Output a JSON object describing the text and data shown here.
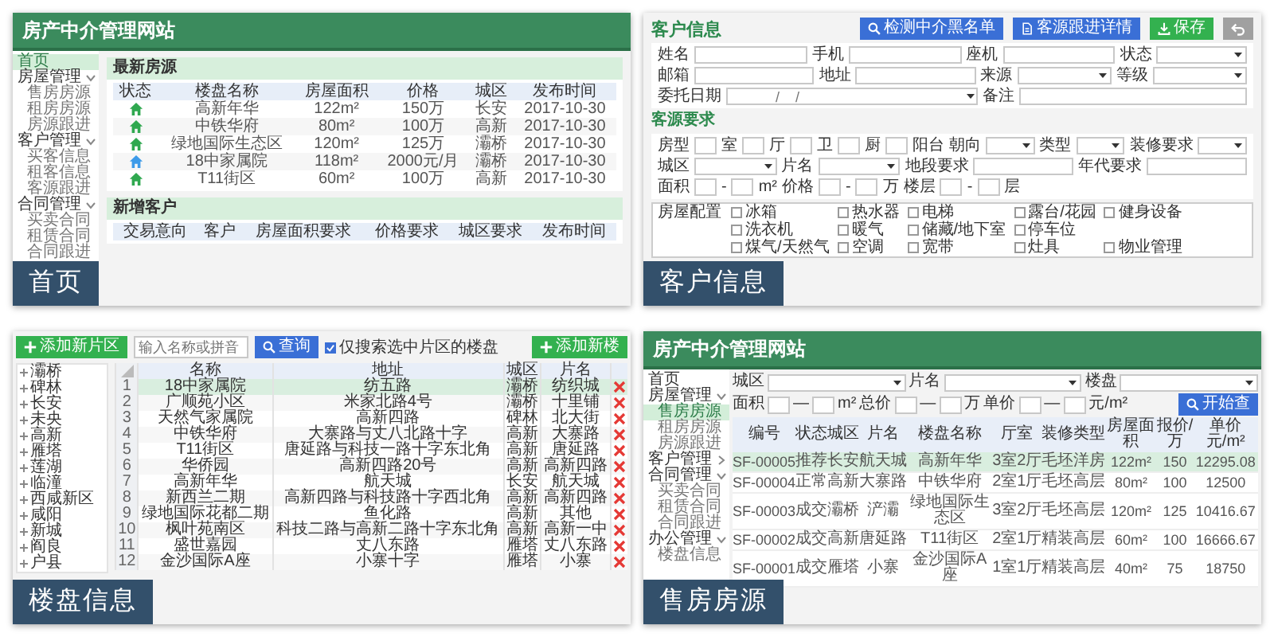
{
  "home_panel": {
    "site_title": "房产中介管理网站",
    "sidebar": [
      {
        "label": "首页",
        "selected": true
      },
      {
        "label": "房屋管理",
        "selected": false,
        "expanded": true,
        "children": [
          {
            "label": "售房房源",
            "selected": false
          },
          {
            "label": "租房房源",
            "selected": false
          },
          {
            "label": "房源跟进",
            "selected": false
          }
        ]
      },
      {
        "label": "客户管理",
        "selected": false,
        "expanded": true,
        "children": [
          {
            "label": "买客信息",
            "selected": false
          },
          {
            "label": "租客信息",
            "selected": false
          },
          {
            "label": "客源跟进",
            "selected": false
          }
        ]
      },
      {
        "label": "合同管理",
        "selected": false,
        "expanded": true,
        "children": [
          {
            "label": "买卖合同",
            "selected": false
          },
          {
            "label": "租赁合同",
            "selected": false
          },
          {
            "label": "合同跟进",
            "selected": false
          }
        ]
      }
    ],
    "latest_listings": {
      "title": "最新房源",
      "columns": [
        "状态",
        "楼盘名称",
        "房屋面积",
        "价格",
        "城区",
        "发布时间"
      ],
      "rows": [
        {
          "kind": "sale",
          "cells": [
            "",
            "高新年华",
            "122m²",
            "150万",
            "长安",
            "2017-10-30"
          ]
        },
        {
          "kind": "sale",
          "cells": [
            "",
            "中铁华府",
            "80m²",
            "100万",
            "高新",
            "2017-10-30"
          ]
        },
        {
          "kind": "sale",
          "cells": [
            "",
            "绿地国际生态区",
            "120m²",
            "125万",
            "灞桥",
            "2017-10-30"
          ]
        },
        {
          "kind": "rent",
          "cells": [
            "",
            "18中家属院",
            "118m²",
            "2000元/月",
            "灞桥",
            "2017-10-30"
          ]
        },
        {
          "kind": "sale",
          "cells": [
            "",
            "T11街区",
            "60m²",
            "100万",
            "高新",
            "2017-10-30"
          ]
        }
      ]
    },
    "new_customers": {
      "title": "新增客户",
      "columns": [
        "交易意向",
        "客户",
        "房屋面积要求",
        "价格要求",
        "城区要求",
        "发布时间"
      ]
    },
    "caption": "首页"
  },
  "customer_panel": {
    "title": "客户信息",
    "buttons": [
      {
        "kind": "search",
        "label": "检测中介黑名单"
      },
      {
        "kind": "document",
        "label": "客源跟进详情"
      },
      {
        "kind": "save",
        "label": "保存"
      },
      {
        "kind": "back"
      }
    ],
    "form_rows": [
      [
        {
          "kind": "text",
          "text": "姓名"
        },
        {
          "kind": "input"
        },
        {
          "kind": "text",
          "text": "手机"
        },
        {
          "kind": "input"
        },
        {
          "kind": "text",
          "text": "座机"
        },
        {
          "kind": "input"
        },
        {
          "kind": "text",
          "text": "状态"
        },
        {
          "kind": "select"
        }
      ],
      [
        {
          "kind": "text",
          "text": "邮箱"
        },
        {
          "kind": "input"
        },
        {
          "kind": "text",
          "text": "地址"
        },
        {
          "kind": "input"
        },
        {
          "kind": "text",
          "text": "来源"
        },
        {
          "kind": "select"
        },
        {
          "kind": "text",
          "text": "等级"
        },
        {
          "kind": "select"
        }
      ],
      [
        {
          "kind": "text",
          "text": "委托日期"
        },
        {
          "kind": "date",
          "placeholder": "____/__/__"
        },
        {
          "kind": "text",
          "text": "备注"
        },
        {
          "kind": "input"
        }
      ]
    ],
    "requirements_title": "客源要求",
    "requirement_rows": [
      [
        {
          "kind": "text",
          "text": "房型"
        },
        {
          "kind": "short"
        },
        {
          "kind": "text",
          "text": "室"
        },
        {
          "kind": "short"
        },
        {
          "kind": "text",
          "text": "厅"
        },
        {
          "kind": "short"
        },
        {
          "kind": "text",
          "text": "卫"
        },
        {
          "kind": "short"
        },
        {
          "kind": "text",
          "text": "厨"
        },
        {
          "kind": "short"
        },
        {
          "kind": "text",
          "text": "阳台"
        },
        {
          "kind": "text",
          "text": "朝向"
        },
        {
          "kind": "select"
        },
        {
          "kind": "text",
          "text": "类型"
        },
        {
          "kind": "select"
        },
        {
          "kind": "text",
          "text": "装修要求"
        },
        {
          "kind": "select"
        }
      ],
      [
        {
          "kind": "text",
          "text": "城区"
        },
        {
          "kind": "select"
        },
        {
          "kind": "text",
          "text": "片名"
        },
        {
          "kind": "select"
        },
        {
          "kind": "text",
          "text": "地段要求"
        },
        {
          "kind": "input"
        },
        {
          "kind": "text",
          "text": "年代要求"
        },
        {
          "kind": "input"
        }
      ],
      [
        {
          "kind": "text",
          "text": "面积"
        },
        {
          "kind": "short"
        },
        {
          "kind": "text",
          "text": "-"
        },
        {
          "kind": "short"
        },
        {
          "kind": "text",
          "text": "m²"
        },
        {
          "kind": "text",
          "text": "价格"
        },
        {
          "kind": "short"
        },
        {
          "kind": "text",
          "text": "-"
        },
        {
          "kind": "short"
        },
        {
          "kind": "text",
          "text": "万"
        },
        {
          "kind": "text",
          "text": "楼层"
        },
        {
          "kind": "short"
        },
        {
          "kind": "text",
          "text": "-"
        },
        {
          "kind": "short"
        },
        {
          "kind": "text",
          "text": "层"
        }
      ]
    ],
    "facilities": {
      "label": "房屋配置",
      "rows": [
        [
          {
            "label": "冰箱",
            "checked": false
          },
          {
            "label": "热水器",
            "checked": false
          },
          {
            "label": "电梯",
            "checked": false
          },
          {
            "label": "露台/花园",
            "checked": false
          },
          {
            "label": "健身设备",
            "checked": false
          }
        ],
        [
          {
            "label": "洗衣机",
            "checked": false
          },
          {
            "label": "暖气",
            "checked": false
          },
          {
            "label": "储藏/地下室",
            "checked": false
          },
          {
            "label": "停车位",
            "checked": false
          }
        ],
        [
          {
            "label": "煤气/天然气",
            "checked": false
          },
          {
            "label": "空调",
            "checked": false
          },
          {
            "label": "宽带",
            "checked": false
          },
          {
            "label": "灶具",
            "checked": false
          },
          {
            "label": "物业管理",
            "checked": false
          }
        ]
      ]
    },
    "caption": "客户信息"
  },
  "estate_panel": {
    "add_district_button": "添加新片区",
    "search_placeholder": "输入名称或拼音",
    "query_button": "查询",
    "filter_checkbox": {
      "label": "仅搜索选中片区的楼盘",
      "checked": true
    },
    "add_estate_button": "添加新楼",
    "districts": [
      {
        "label": "灞桥",
        "expanded": false
      },
      {
        "label": "碑林",
        "expanded": false
      },
      {
        "label": "长安",
        "expanded": false
      },
      {
        "label": "未央",
        "expanded": false
      },
      {
        "label": "高新",
        "expanded": false
      },
      {
        "label": "雁塔",
        "expanded": false
      },
      {
        "label": "莲湖",
        "expanded": false
      },
      {
        "label": "临潼",
        "expanded": false
      },
      {
        "label": "西咸新区",
        "expanded": false
      },
      {
        "label": "咸阳",
        "expanded": false
      },
      {
        "label": "新城",
        "expanded": false
      },
      {
        "label": "阎良",
        "expanded": false
      },
      {
        "label": "户县",
        "expanded": false
      }
    ],
    "table": {
      "columns": [
        "名称",
        "地址",
        "城区",
        "片名"
      ],
      "rows": [
        {
          "number": "1",
          "selected": true,
          "cells": [
            "18中家属院",
            "纺五路",
            "灞桥",
            "纺织城"
          ]
        },
        {
          "number": "2",
          "selected": false,
          "cells": [
            "广顺苑小区",
            "米家北路4号",
            "灞桥",
            "十里铺"
          ]
        },
        {
          "number": "3",
          "selected": false,
          "cells": [
            "天然气家属院",
            "高新四路",
            "碑林",
            "北大街"
          ]
        },
        {
          "number": "4",
          "selected": false,
          "cells": [
            "中铁华府",
            "大寨路与丈八北路十字",
            "高新",
            "大寨路"
          ]
        },
        {
          "number": "5",
          "selected": false,
          "cells": [
            "T11街区",
            "唐延路与科技一路十字东北角",
            "高新",
            "唐延路"
          ]
        },
        {
          "number": "6",
          "selected": false,
          "cells": [
            "华侨园",
            "高新四路20号",
            "高新",
            "高新四路"
          ]
        },
        {
          "number": "7",
          "selected": false,
          "cells": [
            "高新年华",
            "航天城",
            "长安",
            "航天城"
          ]
        },
        {
          "number": "8",
          "selected": false,
          "cells": [
            "新西兰二期",
            "高新四路与科技路十字西北角",
            "高新",
            "高新四路"
          ]
        },
        {
          "number": "9",
          "selected": false,
          "cells": [
            "绿地国际花都二期",
            "鱼化路",
            "高新",
            "其他"
          ]
        },
        {
          "number": "10",
          "selected": false,
          "cells": [
            "枫叶苑南区",
            "科技二路与高新二路十字东北角",
            "高新",
            "高新一中"
          ]
        },
        {
          "number": "11",
          "selected": false,
          "cells": [
            "盛世嘉园",
            "丈八东路",
            "雁塔",
            "丈八东路"
          ]
        },
        {
          "number": "12",
          "selected": false,
          "cells": [
            "金沙国际A座",
            "小寨十字",
            "雁塔",
            "小寨"
          ]
        }
      ]
    },
    "caption": "楼盘信息"
  },
  "sale_panel": {
    "site_title": "房产中介管理网站",
    "sidebar": [
      {
        "label": "首页",
        "selected": false
      },
      {
        "label": "房屋管理",
        "selected": false,
        "expanded": true,
        "children": [
          {
            "label": "售房房源",
            "selected": true
          },
          {
            "label": "租房房源",
            "selected": false
          },
          {
            "label": "房源跟进",
            "selected": false
          }
        ]
      },
      {
        "label": "客户管理",
        "selected": false,
        "expanded": false
      },
      {
        "label": "合同管理",
        "selected": false,
        "expanded": true,
        "children": [
          {
            "label": "买卖合同",
            "selected": false
          },
          {
            "label": "租赁合同",
            "selected": false
          },
          {
            "label": "合同跟进",
            "selected": false
          }
        ]
      },
      {
        "label": "办公管理",
        "selected": false,
        "expanded": true,
        "children": [
          {
            "label": "楼盘信息",
            "selected": false
          }
        ]
      }
    ],
    "filter_rows": [
      [
        {
          "kind": "text",
          "text": "城区"
        },
        {
          "kind": "select"
        },
        {
          "kind": "text",
          "text": "片名"
        },
        {
          "kind": "select"
        },
        {
          "kind": "text",
          "text": "楼盘"
        },
        {
          "kind": "select"
        }
      ],
      [
        {
          "kind": "text",
          "text": "面积"
        },
        {
          "kind": "short"
        },
        {
          "kind": "text",
          "text": "—"
        },
        {
          "kind": "short"
        },
        {
          "kind": "text",
          "text": "m²"
        },
        {
          "kind": "text",
          "text": "总价"
        },
        {
          "kind": "short"
        },
        {
          "kind": "text",
          "text": "—"
        },
        {
          "kind": "short"
        },
        {
          "kind": "text",
          "text": "万"
        },
        {
          "kind": "text",
          "text": "单价"
        },
        {
          "kind": "short"
        },
        {
          "kind": "text",
          "text": "—"
        },
        {
          "kind": "short"
        },
        {
          "kind": "text",
          "text": "元/m²"
        }
      ]
    ],
    "query_button": "开始查",
    "table": {
      "columns": [
        "编号",
        "状态",
        "城区",
        "片名",
        "楼盘名称",
        "厅室",
        "装修",
        "类型",
        "房屋面积",
        "报价/万",
        "单价元/m²"
      ],
      "rows": [
        {
          "selected": true,
          "cells": [
            "SF-00005",
            "推荐",
            "长安",
            "航天城",
            "高新年华",
            "3室2厅",
            "毛坯",
            "洋房",
            "122m²",
            "150",
            "12295.08"
          ]
        },
        {
          "selected": false,
          "cells": [
            "SF-00004",
            "正常",
            "高新",
            "大寨路",
            "中铁华府",
            "2室1厅",
            "毛坯",
            "高层",
            "80m²",
            "100",
            "12500"
          ]
        },
        {
          "selected": false,
          "cells": [
            "SF-00003",
            "成交",
            "灞桥",
            "浐灞",
            "绿地国际生态区",
            "3室2厅",
            "毛坯",
            "高层",
            "120m²",
            "125",
            "10416.67"
          ]
        },
        {
          "selected": false,
          "cells": [
            "SF-00002",
            "成交",
            "高新",
            "唐延路",
            "T11街区",
            "2室1厅",
            "精装",
            "高层",
            "60m²",
            "100",
            "16666.67"
          ]
        },
        {
          "selected": false,
          "cells": [
            "SF-00001",
            "成交",
            "雁塔",
            "小寨",
            "金沙国际A座",
            "1室1厅",
            "精装",
            "高层",
            "40m²",
            "75",
            "18750"
          ]
        }
      ]
    },
    "caption": "售房房源"
  }
}
